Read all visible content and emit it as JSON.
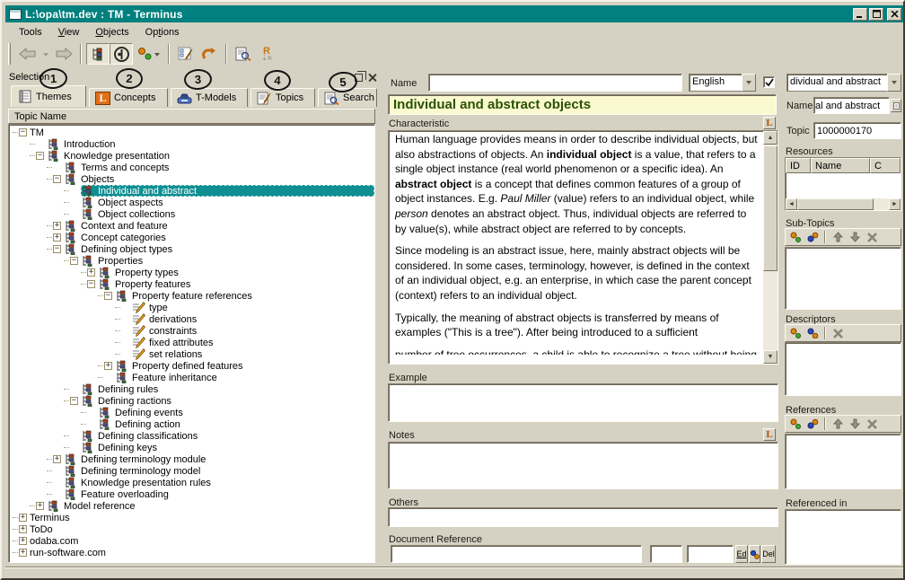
{
  "window": {
    "title": "L:\\opa\\tm.dev : TM - Terminus"
  },
  "menu": {
    "items": [
      {
        "pre": "Tools",
        "u": "",
        "post": ""
      },
      {
        "pre": "",
        "u": "V",
        "post": "iew"
      },
      {
        "pre": "",
        "u": "O",
        "post": "bjects"
      },
      {
        "pre": "Op",
        "u": "t",
        "post": "ions"
      }
    ]
  },
  "toolbar": {
    "icons": [
      "back",
      "back-history",
      "forward",
      "tree-view",
      "circle-view",
      "relations",
      "relations-dropdown",
      "edit-form",
      "undo",
      "preview-document",
      "replace"
    ],
    "replace_letter": "R"
  },
  "selection_panel": {
    "title": "Selection",
    "annotations": [
      "1",
      "2",
      "3",
      "4",
      "5"
    ],
    "tabs": [
      {
        "label": "Themes"
      },
      {
        "label": "Concepts",
        "letter": "L"
      },
      {
        "label": "T-Models"
      },
      {
        "label": "Topics"
      },
      {
        "label": "Search"
      }
    ],
    "tree_header": "Topic Name",
    "tree": [
      {
        "label": "TM",
        "depth": 0,
        "expand": "minus",
        "icon": "none",
        "selected": false
      },
      {
        "label": "Introduction",
        "depth": 1,
        "expand": "none",
        "icon": "topic",
        "selected": false
      },
      {
        "label": "Knowledge presentation",
        "depth": 1,
        "expand": "minus",
        "icon": "topic",
        "selected": false
      },
      {
        "label": "Terms and concepts",
        "depth": 2,
        "expand": "none",
        "icon": "topic",
        "selected": false
      },
      {
        "label": "Objects",
        "depth": 2,
        "expand": "minus",
        "icon": "topic",
        "selected": false
      },
      {
        "label": "Individual and abstract",
        "depth": 3,
        "expand": "none",
        "icon": "topic",
        "selected": true
      },
      {
        "label": "Object aspects",
        "depth": 3,
        "expand": "none",
        "icon": "topic",
        "selected": false
      },
      {
        "label": "Object collections",
        "depth": 3,
        "expand": "none",
        "icon": "topic",
        "selected": false
      },
      {
        "label": "Context and feature",
        "depth": 2,
        "expand": "plus",
        "icon": "topic",
        "selected": false
      },
      {
        "label": "Concept categories",
        "depth": 2,
        "expand": "plus",
        "icon": "topic",
        "selected": false
      },
      {
        "label": "Defining object types",
        "depth": 2,
        "expand": "minus",
        "icon": "topic",
        "selected": false
      },
      {
        "label": "Properties",
        "depth": 3,
        "expand": "minus",
        "icon": "topic",
        "selected": false
      },
      {
        "label": "Property types",
        "depth": 4,
        "expand": "plus",
        "icon": "topic",
        "selected": false
      },
      {
        "label": "Property features",
        "depth": 4,
        "expand": "minus",
        "icon": "topic",
        "selected": false
      },
      {
        "label": "Property feature references",
        "depth": 5,
        "expand": "minus",
        "icon": "topic",
        "selected": false
      },
      {
        "label": "type",
        "depth": 6,
        "expand": "none",
        "icon": "pencil",
        "selected": false
      },
      {
        "label": "derivations",
        "depth": 6,
        "expand": "none",
        "icon": "pencil",
        "selected": false
      },
      {
        "label": "constraints",
        "depth": 6,
        "expand": "none",
        "icon": "pencil",
        "selected": false
      },
      {
        "label": "fixed attributes",
        "depth": 6,
        "expand": "none",
        "icon": "pencil",
        "selected": false
      },
      {
        "label": "set relations",
        "depth": 6,
        "expand": "none",
        "icon": "pencil",
        "selected": false
      },
      {
        "label": "Property defined features",
        "depth": 5,
        "expand": "plus",
        "icon": "topic",
        "selected": false
      },
      {
        "label": "Feature inheritance",
        "depth": 5,
        "expand": "none",
        "icon": "topic",
        "selected": false
      },
      {
        "label": "Defining rules",
        "depth": 3,
        "expand": "none",
        "icon": "topic",
        "selected": false
      },
      {
        "label": "Defining ractions",
        "depth": 3,
        "expand": "minus",
        "icon": "topic",
        "selected": false
      },
      {
        "label": "Defining events",
        "depth": 4,
        "expand": "none",
        "icon": "topic",
        "selected": false
      },
      {
        "label": "Defining action",
        "depth": 4,
        "expand": "none",
        "icon": "topic",
        "selected": false
      },
      {
        "label": "Defining classifications",
        "depth": 3,
        "expand": "none",
        "icon": "topic",
        "selected": false
      },
      {
        "label": "Defining keys",
        "depth": 3,
        "expand": "none",
        "icon": "topic",
        "selected": false
      },
      {
        "label": "Defining terminology module",
        "depth": 2,
        "expand": "plus",
        "icon": "topic",
        "selected": false
      },
      {
        "label": "Defining terminology model",
        "depth": 2,
        "expand": "none",
        "icon": "topic",
        "selected": false
      },
      {
        "label": "Knowledge presentation rules",
        "depth": 2,
        "expand": "none",
        "icon": "topic",
        "selected": false
      },
      {
        "label": "Feature overloading",
        "depth": 2,
        "expand": "none",
        "icon": "topic",
        "selected": false
      },
      {
        "label": "Model reference",
        "depth": 1,
        "expand": "plus",
        "icon": "topic",
        "selected": false
      },
      {
        "label": "Terminus",
        "depth": 0,
        "expand": "plus",
        "icon": "none",
        "selected": false
      },
      {
        "label": "ToDo",
        "depth": 0,
        "expand": "plus",
        "icon": "none",
        "selected": false
      },
      {
        "label": "odaba.com",
        "depth": 0,
        "expand": "plus",
        "icon": "none",
        "selected": false
      },
      {
        "label": "run-software.com",
        "depth": 0,
        "expand": "plus",
        "icon": "none",
        "selected": false
      }
    ]
  },
  "editor": {
    "name_label": "Name",
    "name_value": "",
    "language": "English",
    "language_checked": true,
    "title": "Individual and abstract objects",
    "characteristic_label": "Characteristic",
    "lexicon_letter": "L",
    "characteristic_paragraphs": [
      {
        "clipped": false,
        "runs": [
          {
            "t": "Human language provides means in order to describe individual objects, but also abstractions of objects. An "
          },
          {
            "t": "individual object",
            "b": true
          },
          {
            "t": " is a value, that refers to a single object instance (real world phenomenon or a specific idea). An "
          },
          {
            "t": "abstract object",
            "b": true
          },
          {
            "t": " is a concept that defines common features of a group of object instances. E.g. "
          },
          {
            "t": "Paul Miller",
            "i": true
          },
          {
            "t": " (value) refers to an individual object, while "
          },
          {
            "t": "person",
            "i": true
          },
          {
            "t": " denotes an abstract object. Thus, individual objects are referred to by value(s), while abstract object are referred to by concepts."
          }
        ]
      },
      {
        "clipped": false,
        "runs": [
          {
            "t": "Since modeling is an abstract issue, here, mainly abstract objects will be considered. In some cases, terminology, however, is defined in the context of an individual object, e.g. an enterprise, in which case the parent concept (context) refers to an individual object."
          }
        ]
      },
      {
        "clipped": false,
        "runs": [
          {
            "t": "Typically, the meaning of abstract objects is transferred by means of examples (\"This is a tree\"). After being introduced to a sufficient"
          }
        ]
      },
      {
        "clipped": true,
        "runs": [
          {
            "t": "number of tree occurrences, a child is able to recognize a tree without being"
          }
        ]
      }
    ],
    "example_label": "Example",
    "example_value": "",
    "notes_label": "Notes",
    "notes_value": "",
    "others_label": "Others",
    "others_value": "",
    "docref_label": "Document Reference",
    "docref_value": "",
    "docref_value2": "",
    "docref_value3": "",
    "docref_buttons": {
      "edit": "Ed",
      "delete": "Del"
    }
  },
  "details": {
    "topic_combo": "dividual and abstract",
    "name_label": "Name",
    "name_value": "al and abstract",
    "topic_label": "Topic",
    "topic_value": "1000000170",
    "resources": {
      "label": "Resources",
      "columns": [
        "ID",
        "Name",
        "C"
      ]
    },
    "subtopics_label": "Sub-Topics",
    "descriptors_label": "Descriptors",
    "references_label": "References",
    "referenced_in_label": "Referenced in"
  }
}
